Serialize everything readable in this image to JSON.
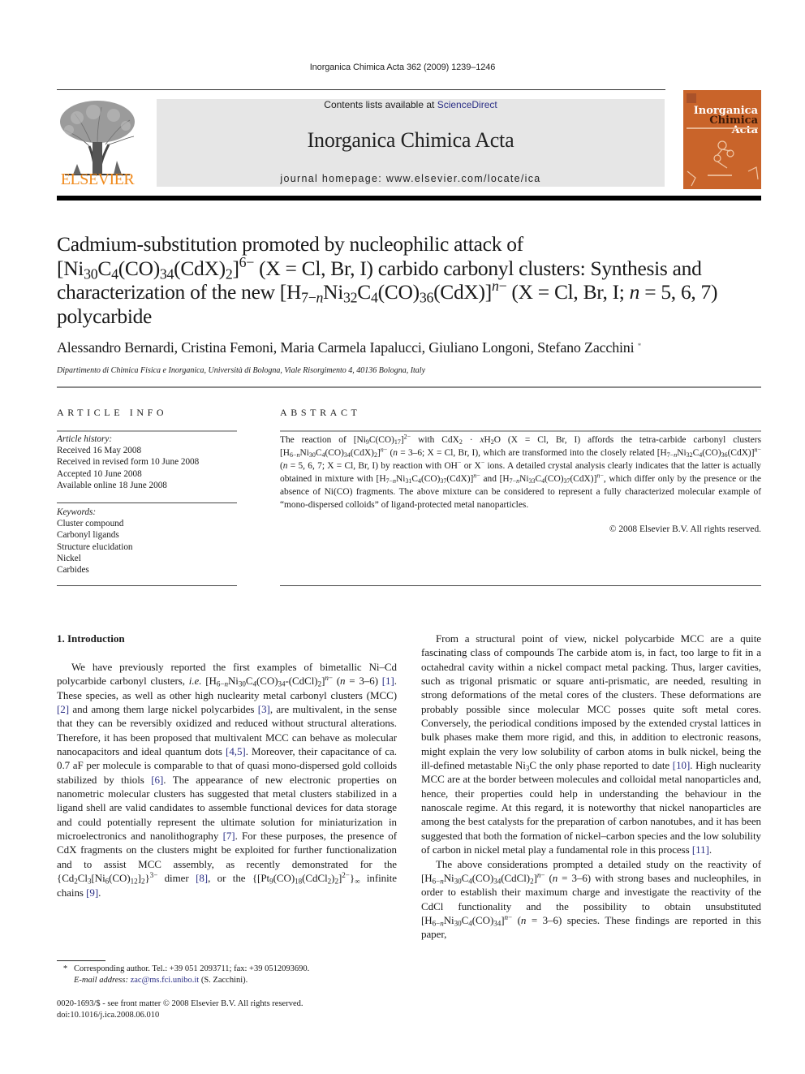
{
  "header": {
    "journal_citation": "Inorganica Chimica Acta 362 (2009) 1239–1246",
    "contents_prefix": "Contents lists available at ",
    "contents_link": "ScienceDirect",
    "journal_name": "Inorganica Chimica Acta",
    "homepage": "journal homepage: www.elsevier.com/locate/ica",
    "publisher_logo_text": "ELSEVIER",
    "cover": {
      "line1": "Inorganica",
      "line2a": "Chimica ",
      "line2b": "Acta"
    },
    "colors": {
      "elsevier_orange": "#f08a1c",
      "cover_orange": "#c9642a",
      "link_blue": "#2b2f86",
      "banner_grey": "#e6e6e6"
    }
  },
  "article": {
    "title": [
      {
        "t": "Cadmium-substitution promoted by nucleophilic attack of "
      },
      {
        "br": true
      },
      {
        "t": "[Ni"
      },
      {
        "t": "30",
        "sub": true
      },
      {
        "t": "C"
      },
      {
        "t": "4",
        "sub": true
      },
      {
        "t": "(CO)"
      },
      {
        "t": "34",
        "sub": true
      },
      {
        "t": "(CdX)"
      },
      {
        "t": "2",
        "sub": true
      },
      {
        "t": "]"
      },
      {
        "t": "6−",
        "sup": true
      },
      {
        "t": " (X = Cl, Br, I) carbido carbonyl clusters: Synthesis and characterization of the new [H"
      },
      {
        "t": "7−",
        "sub": true
      },
      {
        "t": "n",
        "sub": true,
        "i": true
      },
      {
        "t": "Ni"
      },
      {
        "t": "32",
        "sub": true
      },
      {
        "t": "C"
      },
      {
        "t": "4",
        "sub": true
      },
      {
        "t": "(CO)"
      },
      {
        "t": "36",
        "sub": true
      },
      {
        "t": "(CdX)]"
      },
      {
        "t": "n",
        "sup": true,
        "i": true
      },
      {
        "t": "−",
        "sup": true
      },
      {
        "t": " (X = Cl, Br, I; "
      },
      {
        "t": "n",
        "i": true
      },
      {
        "t": " = 5, 6, 7) polycarbide"
      }
    ],
    "authors": "Alessandro Bernardi, Cristina Femoni, Maria Carmela Iapalucci, Giuliano Longoni, Stefano Zacchini",
    "corresponding_mark": "*",
    "affiliation": "Dipartimento di Chimica Fisica e Inorganica, Università di Bologna, Viale Risorgimento 4, 40136 Bologna, Italy"
  },
  "article_info": {
    "heading": "ARTICLE INFO",
    "history_label": "Article history:",
    "history": [
      "Received 16 May 2008",
      "Received in revised form 10 June 2008",
      "Accepted 10 June 2008",
      "Available online 18 June 2008"
    ],
    "keywords_label": "Keywords:",
    "keywords": [
      "Cluster compound",
      "Carbonyl ligands",
      "Structure elucidation",
      "Nickel",
      "Carbides"
    ]
  },
  "abstract": {
    "heading": "ABSTRACT",
    "text": [
      {
        "t": "The reaction of [Ni"
      },
      {
        "t": "9",
        "sub": true
      },
      {
        "t": "C(CO)"
      },
      {
        "t": "17",
        "sub": true
      },
      {
        "t": "]"
      },
      {
        "t": "2−",
        "sup": true
      },
      {
        "t": " with CdX"
      },
      {
        "t": "2",
        "sub": true
      },
      {
        "t": " · "
      },
      {
        "t": "x",
        "i": true
      },
      {
        "t": "H"
      },
      {
        "t": "2",
        "sub": true
      },
      {
        "t": "O (X = Cl, Br, I) affords the tetra-carbide carbonyl clusters [H"
      },
      {
        "t": "6−",
        "sub": true
      },
      {
        "t": "n",
        "sub": true,
        "i": true
      },
      {
        "t": "Ni"
      },
      {
        "t": "30",
        "sub": true
      },
      {
        "t": "C"
      },
      {
        "t": "4",
        "sub": true
      },
      {
        "t": "(CO)"
      },
      {
        "t": "34",
        "sub": true
      },
      {
        "t": "(CdX)"
      },
      {
        "t": "2",
        "sub": true
      },
      {
        "t": "]"
      },
      {
        "t": "n",
        "sup": true,
        "i": true
      },
      {
        "t": "−",
        "sup": true
      },
      {
        "t": " ("
      },
      {
        "t": "n",
        "i": true
      },
      {
        "t": " = 3–6; X = Cl, Br, I), which are transformed into the closely related [H"
      },
      {
        "t": "7−",
        "sub": true
      },
      {
        "t": "n",
        "sub": true,
        "i": true
      },
      {
        "t": "Ni"
      },
      {
        "t": "32",
        "sub": true
      },
      {
        "t": "C"
      },
      {
        "t": "4",
        "sub": true
      },
      {
        "t": "(CO)"
      },
      {
        "t": "36",
        "sub": true
      },
      {
        "t": "(CdX)]"
      },
      {
        "t": "n",
        "sup": true,
        "i": true
      },
      {
        "t": "−",
        "sup": true
      },
      {
        "t": " ("
      },
      {
        "t": "n",
        "i": true
      },
      {
        "t": " = 5, 6, 7; X = Cl, Br, I) by reaction with OH"
      },
      {
        "t": "−",
        "sup": true
      },
      {
        "t": " or X"
      },
      {
        "t": "−",
        "sup": true
      },
      {
        "t": " ions. A detailed crystal analysis clearly indicates that the latter is actually obtained in mixture with [H"
      },
      {
        "t": "7−",
        "sub": true
      },
      {
        "t": "n",
        "sub": true,
        "i": true
      },
      {
        "t": "Ni"
      },
      {
        "t": "31",
        "sub": true
      },
      {
        "t": "C"
      },
      {
        "t": "4",
        "sub": true
      },
      {
        "t": "(CO)"
      },
      {
        "t": "37",
        "sub": true
      },
      {
        "t": "(CdX)]"
      },
      {
        "t": "n",
        "sup": true,
        "i": true
      },
      {
        "t": "−",
        "sup": true
      },
      {
        "t": " and [H"
      },
      {
        "t": "7−",
        "sub": true
      },
      {
        "t": "n",
        "sub": true,
        "i": true
      },
      {
        "t": "Ni"
      },
      {
        "t": "33",
        "sub": true
      },
      {
        "t": "C"
      },
      {
        "t": "4",
        "sub": true
      },
      {
        "t": "(CO)"
      },
      {
        "t": "37",
        "sub": true
      },
      {
        "t": "(CdX)]"
      },
      {
        "t": "n",
        "sup": true,
        "i": true
      },
      {
        "t": "−",
        "sup": true
      },
      {
        "t": ", which differ only by the presence or the absence of Ni(CO) fragments. The above mixture can be considered to represent a fully characterized molecular example of “mono-dispersed colloids” of ligand-protected metal nanoparticles."
      }
    ],
    "copyright": "© 2008 Elsevier B.V. All rights reserved."
  },
  "body": {
    "intro_heading": "1. Introduction",
    "left_paragraphs": [
      [
        {
          "t": "We have previously reported the first examples of bimetallic Ni–Cd polycarbide carbonyl clusters, "
        },
        {
          "t": "i.e.",
          "i": true
        },
        {
          "t": " [H"
        },
        {
          "t": "6−",
          "sub": true
        },
        {
          "t": "n",
          "sub": true,
          "i": true
        },
        {
          "t": "Ni"
        },
        {
          "t": "30",
          "sub": true
        },
        {
          "t": "C"
        },
        {
          "t": "4",
          "sub": true
        },
        {
          "t": "(CO)"
        },
        {
          "t": "34",
          "sub": true
        },
        {
          "t": "-(CdCl)"
        },
        {
          "t": "2",
          "sub": true
        },
        {
          "t": "]"
        },
        {
          "t": "n",
          "sup": true,
          "i": true
        },
        {
          "t": "−",
          "sup": true
        },
        {
          "t": " ("
        },
        {
          "t": "n",
          "i": true
        },
        {
          "t": " = 3–6) "
        },
        {
          "t": "[1]",
          "link": true
        },
        {
          "t": ". These species, as well as other high nuclearity metal carbonyl clusters (MCC) "
        },
        {
          "t": "[2]",
          "link": true
        },
        {
          "t": " and among them large nickel polycarbides "
        },
        {
          "t": "[3]",
          "link": true
        },
        {
          "t": ", are multivalent, in the sense that they can be reversibly oxidized and reduced without structural alterations. Therefore, it has been proposed that multivalent MCC can behave as molecular nanocapacitors and ideal quantum dots "
        },
        {
          "t": "[4,5]",
          "link": true
        },
        {
          "t": ". Moreover, their capacitance of ca. 0.7 aF per molecule is comparable to that of quasi mono-dispersed gold colloids stabilized by thiols "
        },
        {
          "t": "[6]",
          "link": true
        },
        {
          "t": ". The appearance of new electronic properties on nanometric molecular clusters has suggested that metal clusters stabilized in a ligand shell are valid candidates to assemble functional devices for data storage and could potentially represent the ultimate solution for miniaturization in microelectronics and nanolithography "
        },
        {
          "t": "[7]",
          "link": true
        },
        {
          "t": ". For these purposes, the presence of CdX fragments on the clusters might be exploited for further functionalization and to assist MCC assembly, as recently demonstrated for the {Cd"
        },
        {
          "t": "2",
          "sub": true
        },
        {
          "t": "Cl"
        },
        {
          "t": "3",
          "sub": true
        },
        {
          "t": "[Ni"
        },
        {
          "t": "6",
          "sub": true
        },
        {
          "t": "(CO)"
        },
        {
          "t": "12",
          "sub": true
        },
        {
          "t": "]"
        },
        {
          "t": "2",
          "sub": true
        },
        {
          "t": "}"
        },
        {
          "t": "3−",
          "sup": true
        },
        {
          "t": " dimer "
        },
        {
          "t": "[8]",
          "link": true
        },
        {
          "t": ", or the {[Pt"
        },
        {
          "t": "9",
          "sub": true
        },
        {
          "t": "(CO)"
        },
        {
          "t": "18",
          "sub": true
        },
        {
          "t": "(CdCl"
        },
        {
          "t": "2",
          "sub": true
        },
        {
          "t": ")"
        },
        {
          "t": "2",
          "sub": true
        },
        {
          "t": "]"
        },
        {
          "t": "2−",
          "sup": true
        },
        {
          "t": "}"
        },
        {
          "t": "∞",
          "sub": true
        },
        {
          "t": " infinite chains "
        },
        {
          "t": "[9]",
          "link": true
        },
        {
          "t": "."
        }
      ]
    ],
    "right_paragraphs": [
      [
        {
          "t": "From a structural point of view, nickel polycarbide MCC are a quite fascinating class of compounds The carbide atom is, in fact, too large to fit in a octahedral cavity within a nickel compact metal packing. Thus, larger cavities, such as trigonal prismatic or square anti-prismatic, are needed, resulting in strong deformations of the metal cores of the clusters. These deformations are probably possible since molecular MCC posses quite soft metal cores. Conversely, the periodical conditions imposed by the extended crystal lattices in bulk phases make them more rigid, and this, in addition to electronic reasons, might explain the very low solubility of carbon atoms in bulk nickel, being the ill-defined metastable Ni"
        },
        {
          "t": "3",
          "sub": true
        },
        {
          "t": "C the only phase reported to date "
        },
        {
          "t": "[10]",
          "link": true
        },
        {
          "t": ". High nuclearity MCC are at the border between molecules and colloidal metal nanoparticles and, hence, their properties could help in understanding the behaviour in the nanoscale regime. At this regard, it is noteworthy that nickel nanoparticles are among the best catalysts for the preparation of carbon nanotubes, and it has been suggested that both the formation of nickel–carbon species and the low solubility of carbon in nickel metal play a fundamental role in this process "
        },
        {
          "t": "[11]",
          "link": true
        },
        {
          "t": "."
        }
      ],
      [
        {
          "t": "The above considerations prompted a detailed study on the reactivity of [H"
        },
        {
          "t": "6−",
          "sub": true
        },
        {
          "t": "n",
          "sub": true,
          "i": true
        },
        {
          "t": "Ni"
        },
        {
          "t": "30",
          "sub": true
        },
        {
          "t": "C"
        },
        {
          "t": "4",
          "sub": true
        },
        {
          "t": "(CO)"
        },
        {
          "t": "34",
          "sub": true
        },
        {
          "t": "(CdCl)"
        },
        {
          "t": "2",
          "sub": true
        },
        {
          "t": "]"
        },
        {
          "t": "n",
          "sup": true,
          "i": true
        },
        {
          "t": "−",
          "sup": true
        },
        {
          "t": " ("
        },
        {
          "t": "n",
          "i": true
        },
        {
          "t": " = 3–6) with strong bases and nucleophiles, in order to establish their maximum charge and investigate the reactivity of the CdCl functionality and the possibility to obtain unsubstituted [H"
        },
        {
          "t": "6−",
          "sub": true
        },
        {
          "t": "n",
          "sub": true,
          "i": true
        },
        {
          "t": "Ni"
        },
        {
          "t": "30",
          "sub": true
        },
        {
          "t": "C"
        },
        {
          "t": "4",
          "sub": true
        },
        {
          "t": "(CO)"
        },
        {
          "t": "34",
          "sub": true
        },
        {
          "t": "]"
        },
        {
          "t": "n",
          "sup": true,
          "i": true
        },
        {
          "t": "−",
          "sup": true
        },
        {
          "t": " ("
        },
        {
          "t": "n",
          "i": true
        },
        {
          "t": " = 3–6) species. These findings are reported in this paper,"
        }
      ]
    ]
  },
  "footnotes": {
    "star": "*",
    "corresponding": "Corresponding author. Tel.: +39 051 2093711; fax: +39 0512093690.",
    "email_label": "E-mail address: ",
    "email": "zac@ms.fci.unibo.it",
    "email_suffix": " (S. Zacchini).",
    "issn_line": "0020-1693/$ - see front matter © 2008 Elsevier B.V. All rights reserved.",
    "doi": "doi:10.1016/j.ica.2008.06.010"
  }
}
